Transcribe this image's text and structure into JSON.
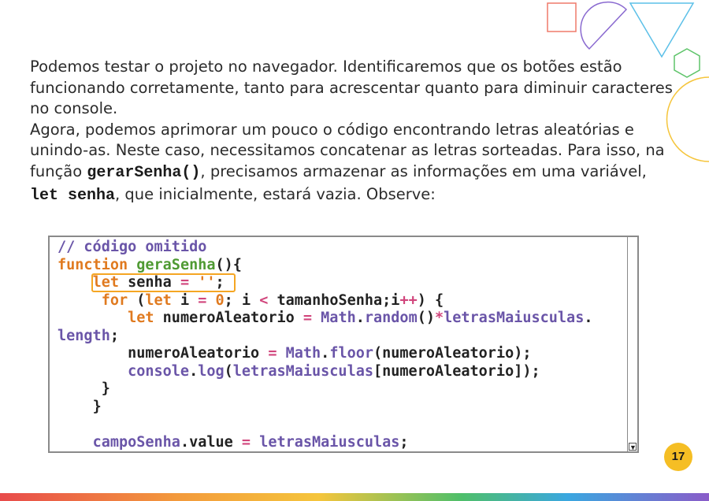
{
  "paragraph": {
    "p1": "Podemos testar o projeto no navegador. Identificaremos que os botões estão funcionando corretamente, tanto para acrescentar quanto para diminuir caracteres no console.",
    "p2_a": "Agora, podemos aprimorar um pouco o código encontrando letras aleatórias e unindo-as. Neste caso, necessitamos concatenar as letras sorteadas. Para isso, na função ",
    "p2_code1": "gerarSenha()",
    "p2_b": ", precisamos armazenar as informações em uma variável, ",
    "p2_code2": "let senha",
    "p2_c": ", que inicialmente, estará vazia. Observe:"
  },
  "code": {
    "comment": "// código omitido",
    "kw_function": "function",
    "fn_name": "geraSenha",
    "l2_rest": "(){",
    "kw_let": "let",
    "var_senha": " senha ",
    "op_eq": "=",
    "str_empty": " ''",
    "semi": ";",
    "kw_for": "for",
    "for_open": " (",
    "var_i": " i ",
    "num_zero": " 0",
    "for_mid": "; i ",
    "op_lt": "<",
    "for_rest": " tamanhoSenha;i",
    "op_inc": "++",
    "for_close": ") {",
    "var_num": " numeroAleatorio ",
    "math": " Math",
    "dot": ".",
    "random": "random",
    "paren_open": "(",
    "paren_close": ")",
    "op_mul": "*",
    "letras": "letrasMaiusculas",
    "length": "length",
    "numAl": "numeroAleatorio ",
    "floor": "floor",
    "numAl2": "numeroAleatorio",
    "paren_close_semi": ");",
    "console": "console",
    "log": "log",
    "brk_open": "[",
    "brk_close": "]",
    "end": "]);",
    "brace": "}",
    "campoSenha": "campoSenha",
    "value": ".value ",
    "letras_end": " letrasMaiusculas",
    "scroll_arrow": "▼"
  },
  "page_number": "17",
  "colors": {
    "keyword": "#e07a1f",
    "function_name": "#4f9a33",
    "property": "#6a55a8",
    "operator": "#d1457c",
    "highlight": "#f5a623",
    "badge": "#f5be24"
  }
}
